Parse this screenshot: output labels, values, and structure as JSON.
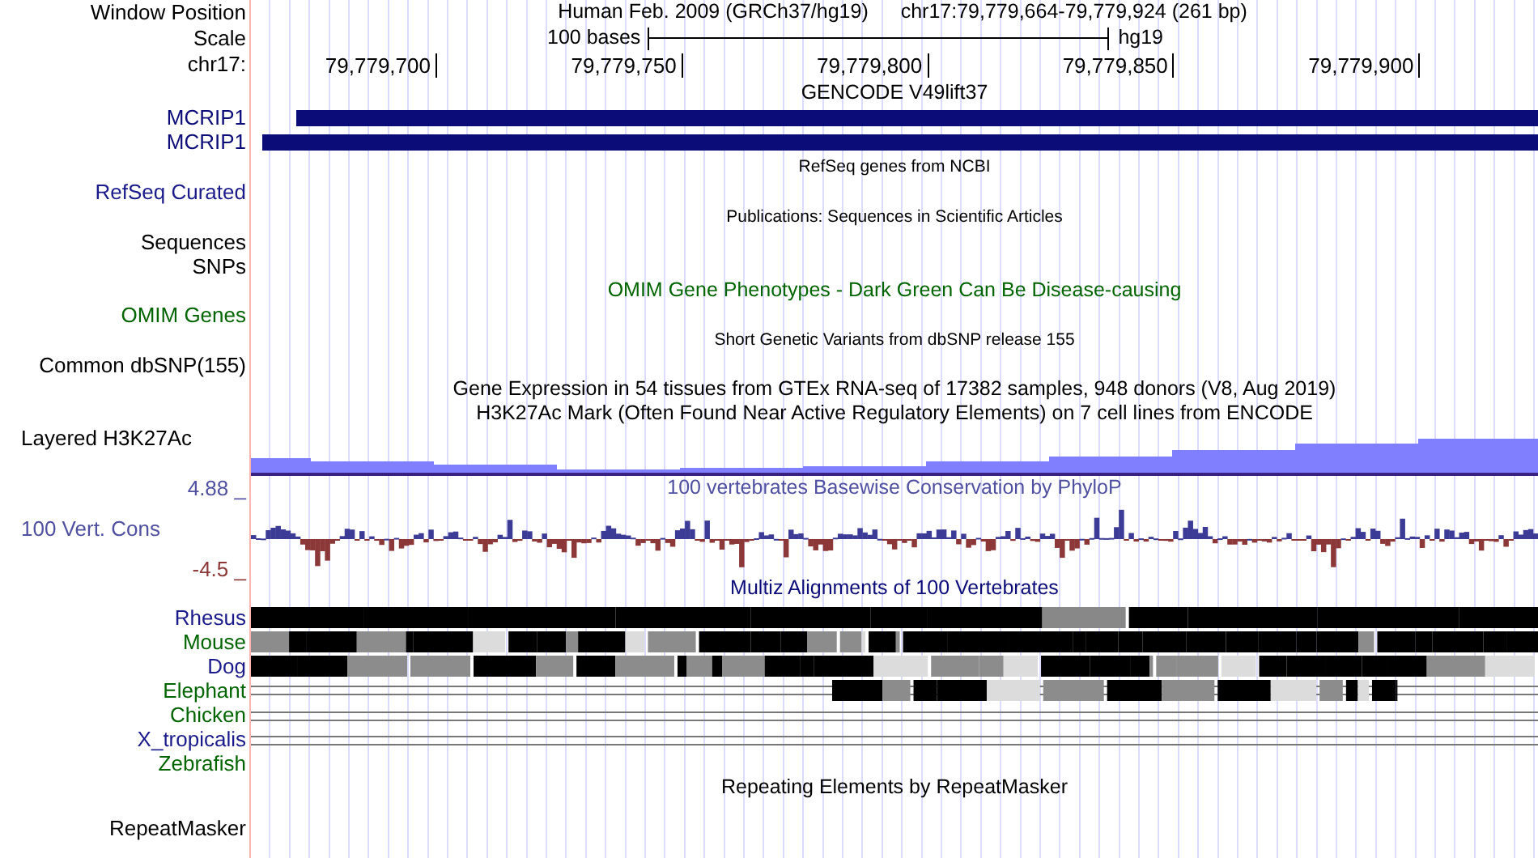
{
  "header": {
    "label": "Window Position",
    "assembly": "Human Feb. 2009 (GRCh37/hg19)",
    "position": "chr17:79,779,664-79,779,924 (261 bp)"
  },
  "scale": {
    "label": "Scale",
    "length": "100 bases",
    "assembly": "hg19"
  },
  "ruler": {
    "label": "chr17:",
    "ticks": [
      "79,779,700",
      "79,779,750",
      "79,779,800",
      "79,779,850",
      "79,779,900"
    ]
  },
  "tracks": [
    {
      "kind": "title",
      "text": "GENCODE V49lift37",
      "color": "#000000"
    },
    {
      "kind": "gene",
      "label": "MCRIP1",
      "color": "#0c0c78"
    },
    {
      "kind": "gene",
      "label": "MCRIP1",
      "color": "#0c0c78"
    },
    {
      "kind": "note",
      "text": "RefSeq genes from NCBI"
    },
    {
      "kind": "label",
      "label": "RefSeq Curated",
      "color": "#1a1a8a"
    },
    {
      "kind": "note",
      "text": "Publications: Sequences in Scientific Articles"
    },
    {
      "kind": "label",
      "label": "Sequences",
      "color": "#000000"
    },
    {
      "kind": "label",
      "label": "SNPs",
      "color": "#000000"
    },
    {
      "kind": "title",
      "text": "OMIM Gene Phenotypes - Dark Green Can Be Disease-causing",
      "color": "#006400"
    },
    {
      "kind": "label",
      "label": "OMIM Genes",
      "color": "#006400"
    },
    {
      "kind": "note",
      "text": "Short Genetic Variants from dbSNP release 155"
    },
    {
      "kind": "label",
      "label": "Common dbSNP(155)",
      "color": "#000000"
    },
    {
      "kind": "title",
      "text": "Gene Expression in 54 tissues from GTEx RNA-seq of 17382 samples, 948 donors (V8, Aug 2019)",
      "color": "#000000"
    },
    {
      "kind": "title",
      "text": "H3K27Ac Mark (Often Found Near Active Regulatory Elements) on 7 cell lines from ENCODE",
      "color": "#000000"
    },
    {
      "kind": "signal",
      "label": "Layered H3K27Ac",
      "color": "#000000"
    },
    {
      "kind": "wiggle",
      "label": "100 Vert. Cons",
      "color": "#5050a0",
      "top": "4.88 _",
      "bottom": "-4.5 _",
      "title": "100 vertebrates Basewise Conservation by PhyloP"
    },
    {
      "kind": "title",
      "text": "Multiz Alignments of 100 Vertebrates",
      "color": "#0c0c78"
    },
    {
      "kind": "dense",
      "label": "Rhesus",
      "color": "#1a1a8a"
    },
    {
      "kind": "mixed",
      "label": "Mouse",
      "color": "#006400"
    },
    {
      "kind": "mixed",
      "label": "Dog",
      "color": "#1a1a8a"
    },
    {
      "kind": "partial",
      "label": "Elephant",
      "color": "#006400"
    },
    {
      "kind": "gaps",
      "label": "Chicken",
      "color": "#006400"
    },
    {
      "kind": "gaps",
      "label": "X_tropicalis",
      "color": "#1a1a8a"
    },
    {
      "kind": "blank",
      "label": "Zebrafish",
      "color": "#006400"
    },
    {
      "kind": "title",
      "text": "Repeating Elements by RepeatMasker",
      "color": "#000000"
    },
    {
      "kind": "tall-label",
      "label": "RepeatMasker",
      "color": "#000000"
    }
  ]
}
